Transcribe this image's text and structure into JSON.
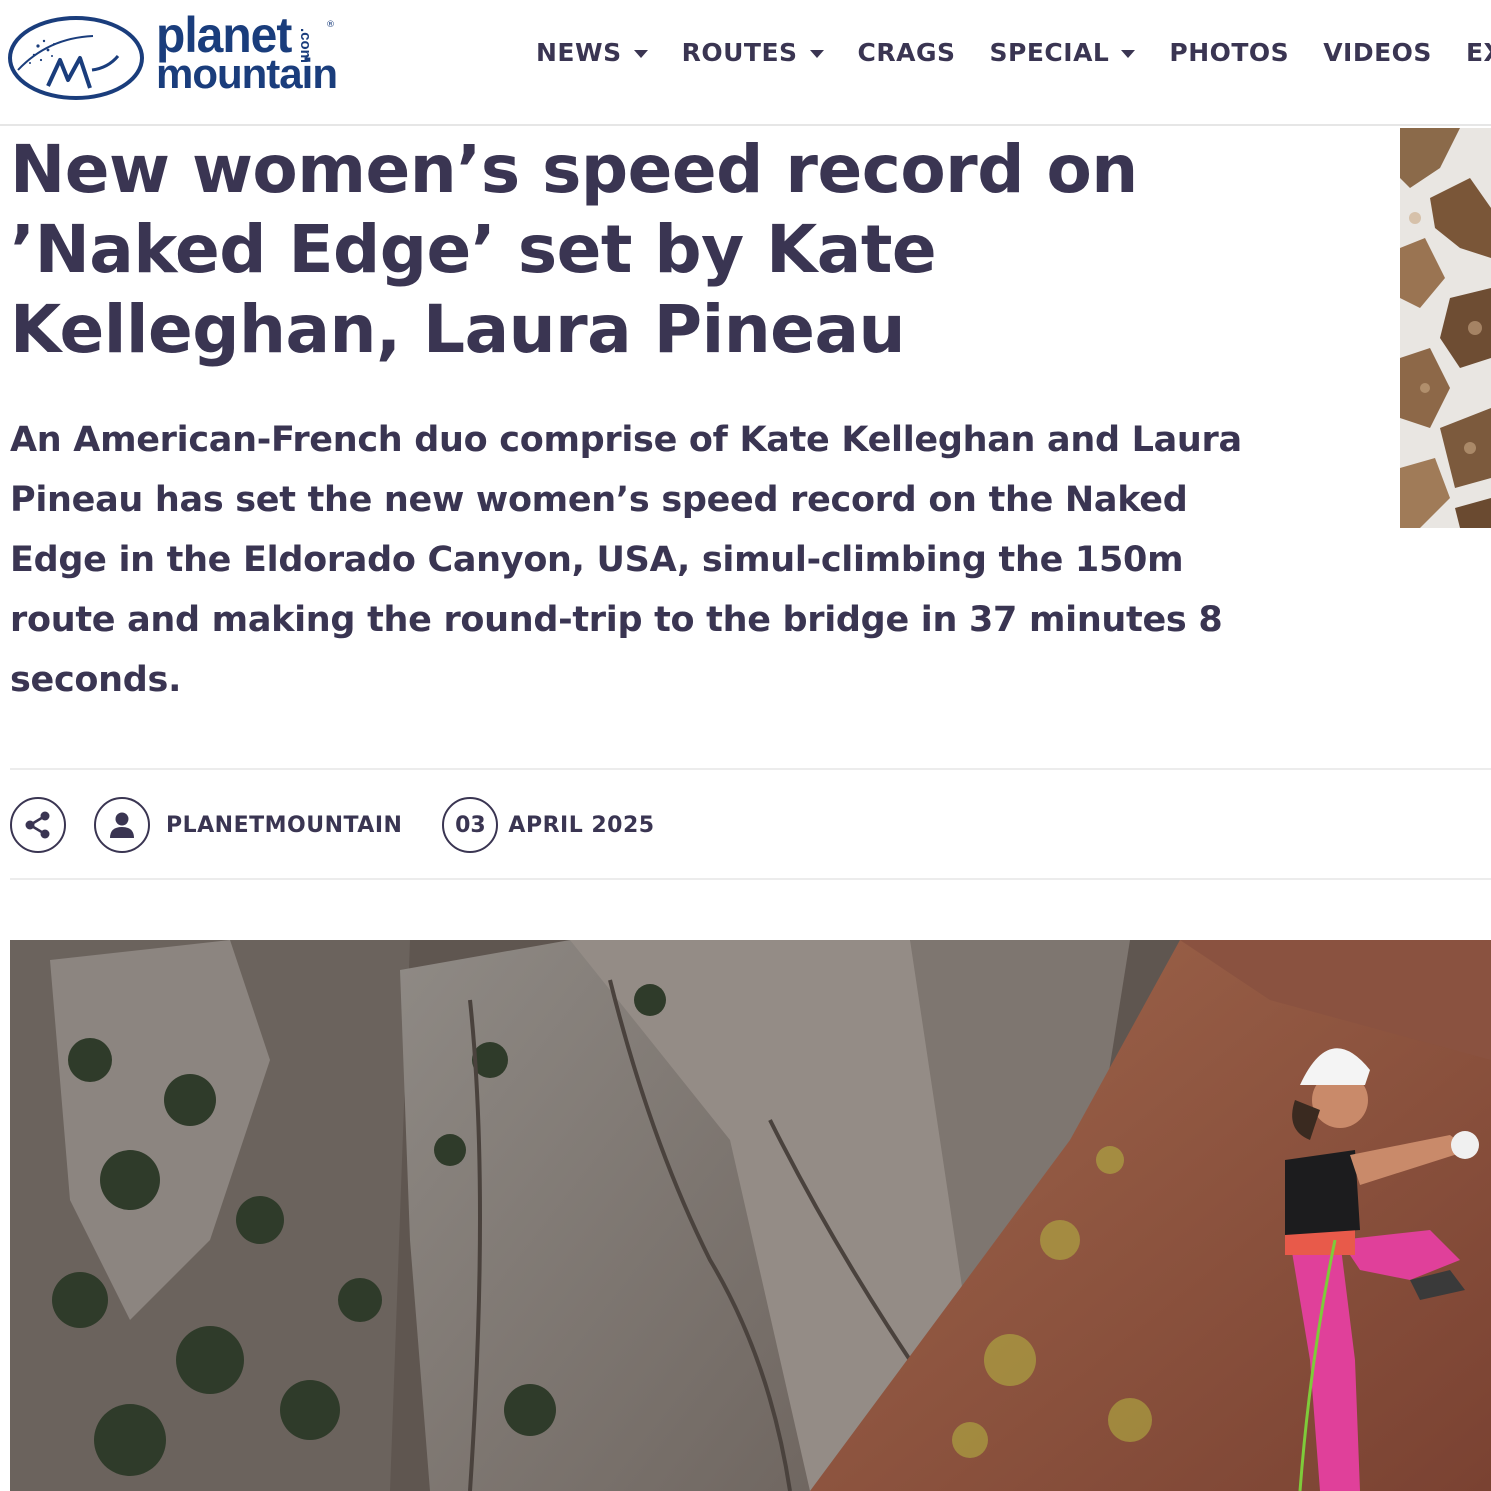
{
  "header": {
    "logo_line1": "planet",
    "logo_line2": "mountain",
    "logo_dotcom": ".com",
    "logo_reg": "®"
  },
  "nav": {
    "items": [
      {
        "label": "NEWS",
        "dropdown": true
      },
      {
        "label": "ROUTES",
        "dropdown": true
      },
      {
        "label": "CRAGS",
        "dropdown": false
      },
      {
        "label": "SPECIAL",
        "dropdown": true
      },
      {
        "label": "PHOTOS",
        "dropdown": false
      },
      {
        "label": "VIDEOS",
        "dropdown": false
      },
      {
        "label": "EX",
        "dropdown": false
      }
    ]
  },
  "article": {
    "title_line1": "New women’s speed record on",
    "title_line2": "’Naked Edge’ set by Kate",
    "title_line3": "Kelleghan, Laura Pineau",
    "lead": "An American-French duo comprise of Kate Kelleghan and Laura Pineau has set the new women’s speed record on the Naked Edge in the Eldorado Canyon, USA, simul-climbing the 150m route and making the round-trip to the bridge in 37 minutes 8 seconds.",
    "author": "PLANETMOUNTAIN",
    "date_day": "03",
    "date_rest": "APRIL 2025"
  },
  "icons": {
    "share": "share-icon",
    "author": "user-icon"
  },
  "colors": {
    "text": "#3a3552",
    "brand": "#1a3d7c",
    "divider": "#ececec"
  }
}
